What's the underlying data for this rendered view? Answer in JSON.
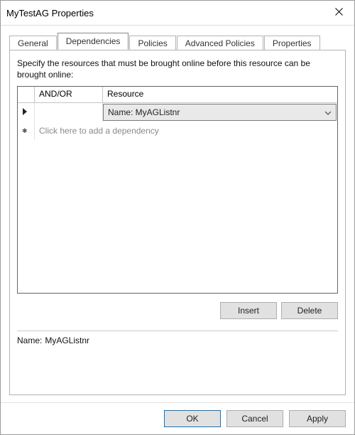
{
  "window": {
    "title": "MyTestAG Properties"
  },
  "tabs": {
    "general": "General",
    "dependencies": "Dependencies",
    "policies": "Policies",
    "advanced_policies": "Advanced Policies",
    "properties": "Properties",
    "active": "dependencies"
  },
  "panel": {
    "instructions": "Specify the resources that must be brought online before this resource can be brought online:",
    "headers": {
      "andor": "AND/OR",
      "resource": "Resource"
    },
    "rows": [
      {
        "andor": "",
        "resource_display": "Name: MyAGListnr",
        "selected": true
      }
    ],
    "new_row_placeholder": "Click here to add a dependency",
    "buttons": {
      "insert": "Insert",
      "delete": "Delete"
    },
    "name_label": "Name:",
    "name_value": "MyAGListnr"
  },
  "footer": {
    "ok": "OK",
    "cancel": "Cancel",
    "apply": "Apply"
  }
}
